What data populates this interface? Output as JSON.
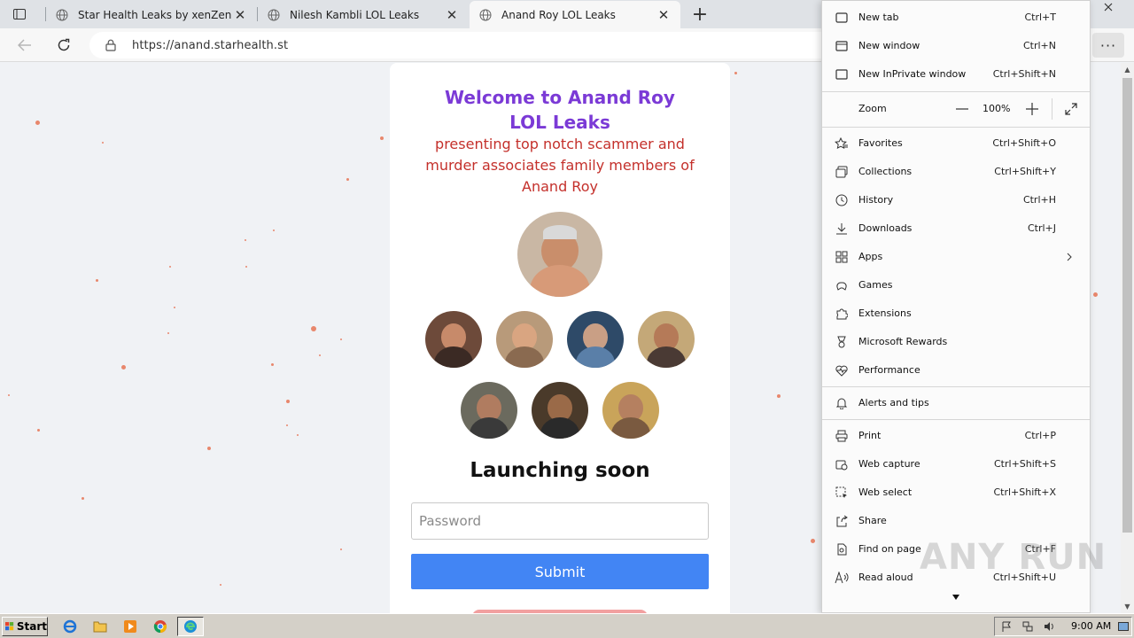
{
  "browser": {
    "tabs": [
      {
        "title": "Star Health Leaks by xenZen",
        "active": false
      },
      {
        "title": "Nilesh Kambli LOL Leaks",
        "active": false
      },
      {
        "title": "Anand Roy LOL Leaks",
        "active": true
      }
    ],
    "url": "https://anand.starhealth.st"
  },
  "page": {
    "heading": "Welcome to Anand Roy LOL Leaks",
    "subtitle": "presenting top notch scammer and murder associates family members of Anand Roy",
    "launch_text": "Launching soon",
    "password_placeholder": "Password",
    "submit_label": "Submit",
    "accent_colors": {
      "heading": "#7b3ad6",
      "subtitle": "#c4302b",
      "submit": "#4285f4"
    }
  },
  "menu": {
    "items_top": [
      {
        "label": "New tab",
        "shortcut": "Ctrl+T",
        "icon": "new-tab-icon"
      },
      {
        "label": "New window",
        "shortcut": "Ctrl+N",
        "icon": "new-window-icon"
      },
      {
        "label": "New InPrivate window",
        "shortcut": "Ctrl+Shift+N",
        "icon": "inprivate-icon"
      }
    ],
    "zoom": {
      "label": "Zoom",
      "value": "100%"
    },
    "items_mid": [
      {
        "label": "Favorites",
        "shortcut": "Ctrl+Shift+O",
        "icon": "favorites-icon"
      },
      {
        "label": "Collections",
        "shortcut": "Ctrl+Shift+Y",
        "icon": "collections-icon"
      },
      {
        "label": "History",
        "shortcut": "Ctrl+H",
        "icon": "history-icon"
      },
      {
        "label": "Downloads",
        "shortcut": "Ctrl+J",
        "icon": "downloads-icon"
      },
      {
        "label": "Apps",
        "shortcut": "",
        "icon": "apps-icon"
      },
      {
        "label": "Games",
        "shortcut": "",
        "icon": "games-icon"
      },
      {
        "label": "Extensions",
        "shortcut": "",
        "icon": "extensions-icon"
      },
      {
        "label": "Microsoft Rewards",
        "shortcut": "",
        "icon": "rewards-icon"
      },
      {
        "label": "Performance",
        "shortcut": "",
        "icon": "performance-icon"
      }
    ],
    "items_alerts": [
      {
        "label": "Alerts and tips",
        "shortcut": "",
        "icon": "bell-icon"
      }
    ],
    "items_bottom": [
      {
        "label": "Print",
        "shortcut": "Ctrl+P",
        "icon": "print-icon"
      },
      {
        "label": "Web capture",
        "shortcut": "Ctrl+Shift+S",
        "icon": "web-capture-icon"
      },
      {
        "label": "Web select",
        "shortcut": "Ctrl+Shift+X",
        "icon": "web-select-icon"
      },
      {
        "label": "Share",
        "shortcut": "",
        "icon": "share-icon"
      },
      {
        "label": "Find on page",
        "shortcut": "Ctrl+F",
        "icon": "find-icon"
      },
      {
        "label": "Read aloud",
        "shortcut": "Ctrl+Shift+U",
        "icon": "read-aloud-icon"
      }
    ]
  },
  "watermark": "ANY RUN",
  "taskbar": {
    "start_label": "Start",
    "clock": "9:00 AM",
    "pinned": [
      "ie-icon",
      "folder-icon",
      "media-player-icon",
      "chrome-icon",
      "edge-icon"
    ]
  }
}
